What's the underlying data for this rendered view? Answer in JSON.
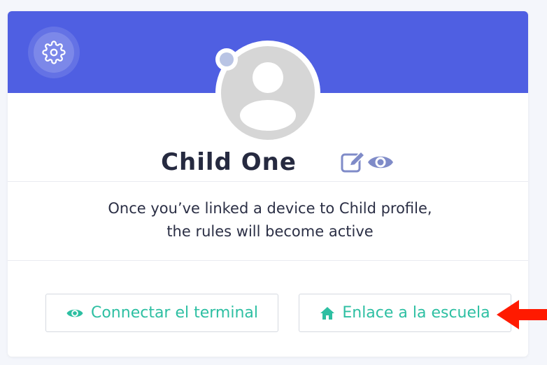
{
  "profile": {
    "name": "Child One",
    "message": "Once you’ve linked a device to Child profile, the rules will become active"
  },
  "icons": {
    "settings": "gear-icon",
    "edit": "edit-icon",
    "view": "eye-icon",
    "avatar": "user-placeholder",
    "status": "status-dot"
  },
  "actions": {
    "connect_label": "Connectar el terminal",
    "school_label": "Enlace a la escuela"
  },
  "colors": {
    "banner": "#4f5fe2",
    "accent": "#2dbfa2",
    "icon_muted": "#7f8bc8",
    "annotation_arrow": "#ff1a00"
  }
}
